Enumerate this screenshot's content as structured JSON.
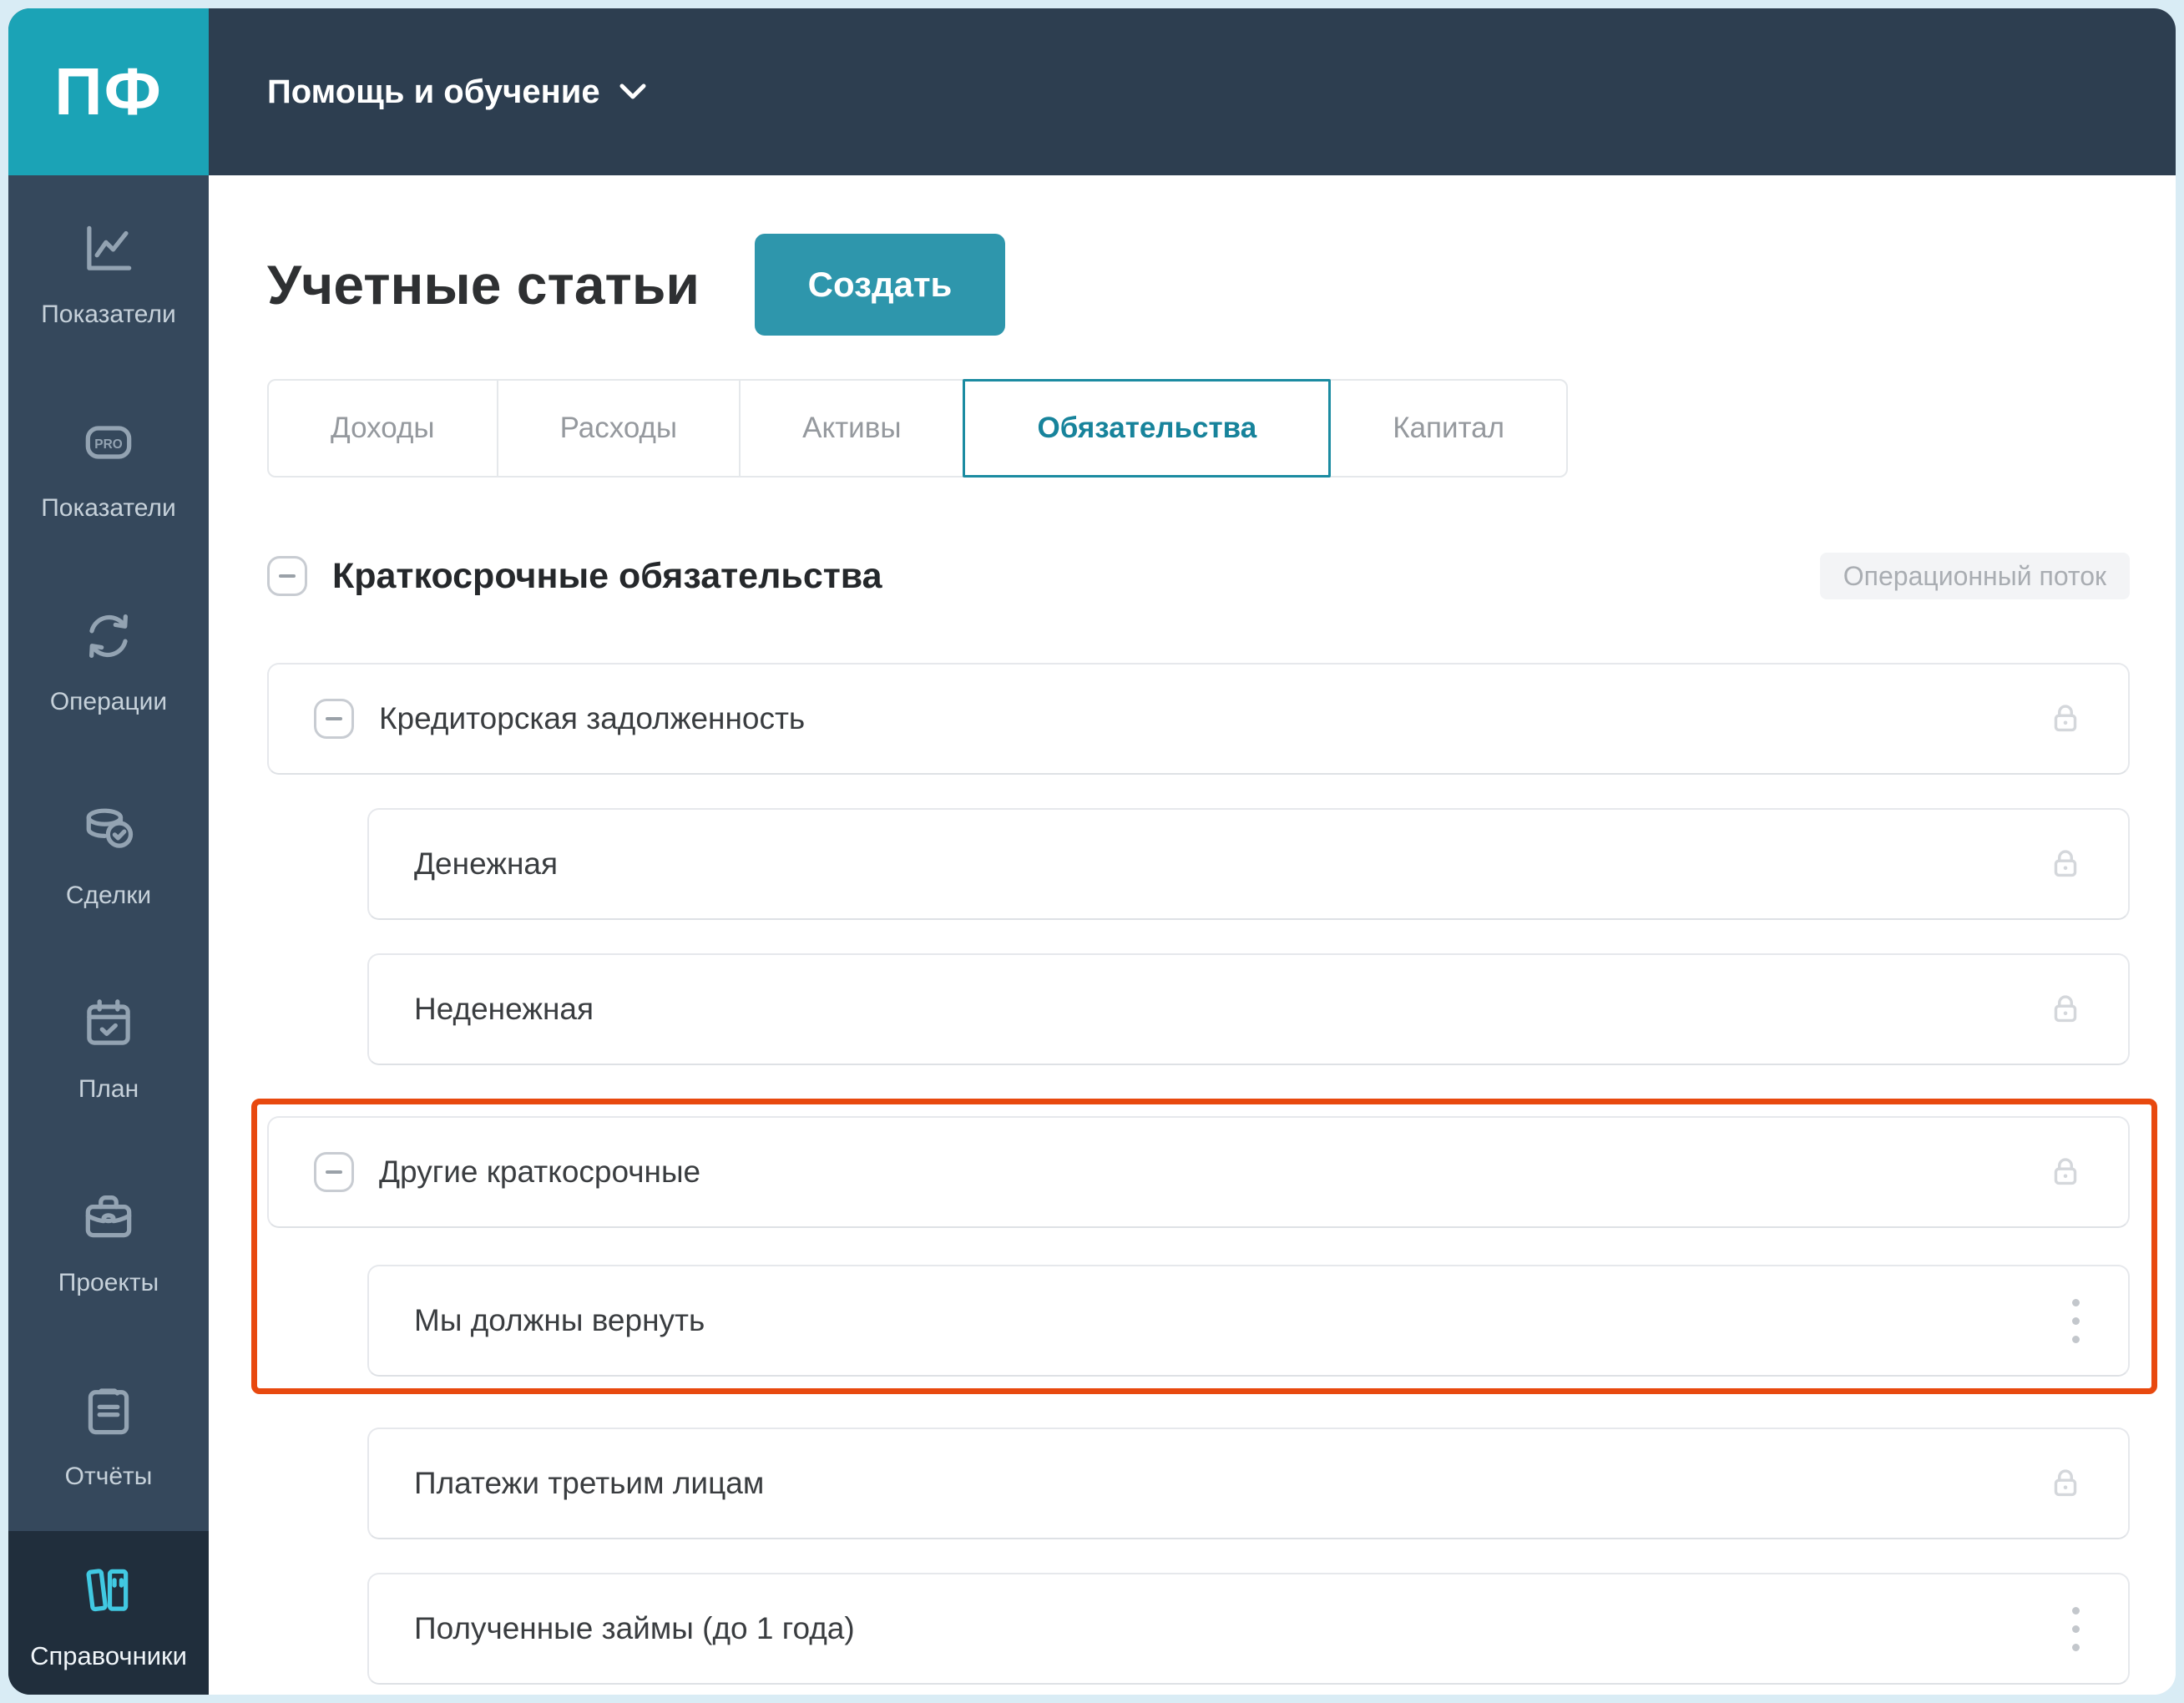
{
  "app": {
    "logo": "ПФ"
  },
  "topbar": {
    "menu_label": "Помощь и обучение",
    "menu_icon": "chevron-down-icon"
  },
  "sidebar": {
    "items": [
      {
        "label": "Показатели",
        "icon": "line-chart-icon",
        "active": false
      },
      {
        "label": "Показатели",
        "icon": "pro-badge-icon",
        "active": false
      },
      {
        "label": "Операции",
        "icon": "sync-arrows-icon",
        "active": false
      },
      {
        "label": "Сделки",
        "icon": "coins-check-icon",
        "active": false
      },
      {
        "label": "План",
        "icon": "calendar-check-icon",
        "active": false
      },
      {
        "label": "Проекты",
        "icon": "briefcase-icon",
        "active": false
      },
      {
        "label": "Отчёты",
        "icon": "clipboard-icon",
        "active": false
      },
      {
        "label": "Справочники",
        "icon": "books-icon",
        "active": true
      }
    ]
  },
  "main": {
    "title": "Учетные статьи",
    "create_button": "Создать",
    "tabs": [
      {
        "label": "Доходы",
        "active": false
      },
      {
        "label": "Расходы",
        "active": false
      },
      {
        "label": "Активы",
        "active": false
      },
      {
        "label": "Обязательства",
        "active": true
      },
      {
        "label": "Капитал",
        "active": false
      }
    ],
    "section": {
      "title": "Краткосрочные обязательства",
      "badge": "Операционный поток",
      "collapse_icon": "minus"
    },
    "rows": [
      {
        "label": "Кредиторская задолженность",
        "level": 1,
        "collapse_icon": "minus",
        "right_icon": "lock",
        "highlighted": false
      },
      {
        "label": "Денежная",
        "level": 2,
        "collapse_icon": null,
        "right_icon": "lock",
        "highlighted": false
      },
      {
        "label": "Неденежная",
        "level": 2,
        "collapse_icon": null,
        "right_icon": "lock",
        "highlighted": false
      },
      {
        "label": "Другие краткосрочные",
        "level": 1,
        "collapse_icon": "minus",
        "right_icon": "lock",
        "highlighted": true
      },
      {
        "label": "Мы должны вернуть",
        "level": 2,
        "collapse_icon": null,
        "right_icon": "kebab",
        "highlighted": true
      },
      {
        "label": "Платежи третьим лицам",
        "level": 2,
        "collapse_icon": null,
        "right_icon": "lock",
        "highlighted": false
      },
      {
        "label": "Полученные займы (до 1 года)",
        "level": 2,
        "collapse_icon": null,
        "right_icon": "kebab",
        "highlighted": false
      }
    ]
  },
  "colors": {
    "frame": "#d9ecf5",
    "topbar": "#2d3e50",
    "sidebar": "#35485c",
    "sidebar_active": "#202e3c",
    "logo_teal": "#1ba3b6",
    "button_teal": "#2e96ac",
    "tab_active": "#1b8ba1",
    "highlight_orange": "#e8490f"
  }
}
